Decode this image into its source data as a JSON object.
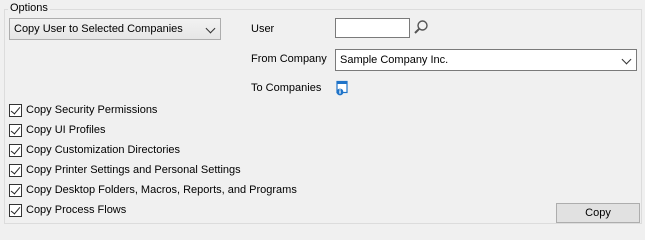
{
  "options": {
    "group_title": "Options",
    "mode_select": {
      "value": "Copy User to Selected Companies"
    }
  },
  "user": {
    "label": "User",
    "value": ""
  },
  "from_company": {
    "label": "From Company",
    "value": "Sample Company Inc."
  },
  "to_companies": {
    "label": "To Companies"
  },
  "checkboxes": [
    {
      "label": "Copy Security Permissions",
      "checked": true
    },
    {
      "label": "Copy UI Profiles",
      "checked": true
    },
    {
      "label": "Copy Customization Directories",
      "checked": true
    },
    {
      "label": "Copy Printer Settings and Personal Settings",
      "checked": true
    },
    {
      "label": "Copy Desktop Folders, Macros, Reports, and Programs",
      "checked": true
    },
    {
      "label": "Copy Process Flows",
      "checked": true
    }
  ],
  "copy_button": {
    "label": "Copy"
  },
  "icons": {
    "search": "search-icon",
    "companies": "companies-list-icon"
  },
  "colors": {
    "icon_blue": "#1e73c8",
    "background": "#f0f0f0"
  }
}
